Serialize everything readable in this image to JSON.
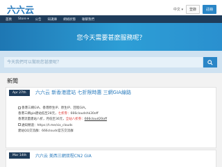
{
  "header": {
    "logo": "六六云",
    "lang": "中文 ▾",
    "login": "登錄",
    "register": "註冊"
  },
  "nav": {
    "items": [
      "首頁",
      "Store ▾",
      "公告",
      "知識庫",
      "網絡狀態",
      "聯繫我們"
    ]
  },
  "hero": {
    "title": "您今天需要甚麼服務呢？"
  },
  "search": {
    "placeholder": "今天我們可以幫助您甚麼呢？"
  },
  "news": {
    "section_title": "新聞",
    "items": [
      {
        "date": "Apr 27th",
        "title": "六六云 新香港建站 七折限時惠 三網GIA線路",
        "lines": [
          {
            "text": "香港三網GIA、香港原生IP、原生IP、回程GIA。"
          },
          {
            "text": "香港三網gia建站低至28元，",
            "red": "七折券：",
            "code": "666cloudshk30off"
          },
          {
            "text": "香港流量建站八折，月低至36元，",
            "red": "全站八折券：",
            "code": "666cloud20off"
          },
          {
            "text": "通知頻道：https://t.me/six_clouds"
          },
          {
            "text": "建站QQ交流群：666clouds官方交流群"
          }
        ]
      },
      {
        "date": "Mar 14th",
        "title": "六六云 美西三網双程CN2 GIA"
      }
    ]
  },
  "colors": {
    "brand": "#2a7bbd",
    "nav_bg": "#1f3c5a",
    "hero": "#2a90cf",
    "coupon": "#d9302c"
  }
}
